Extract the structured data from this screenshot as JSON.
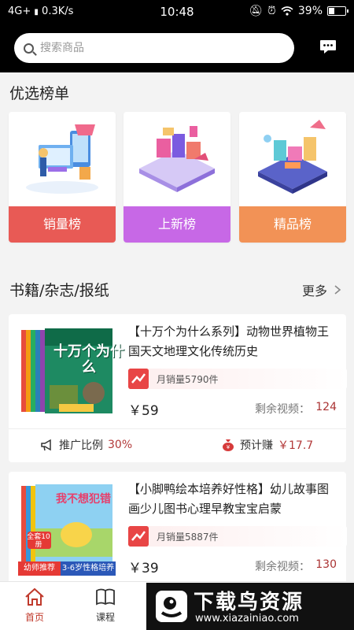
{
  "status": {
    "network": "4G+",
    "speed": "0.3K/s",
    "time": "10:48",
    "battery": "39%",
    "battery_level": 0.39
  },
  "search": {
    "placeholder": "搜索商品"
  },
  "ranking": {
    "title": "优选榜单",
    "items": [
      {
        "label": "销量榜",
        "color": "#e85a55"
      },
      {
        "label": "上新榜",
        "color": "#c768e6"
      },
      {
        "label": "精品榜",
        "color": "#f29256"
      }
    ]
  },
  "books": {
    "title": "书籍/杂志/报纸",
    "more": "更多",
    "items": [
      {
        "title": "【十万个为什么系列】动物世界植物王国天文地理文化传统历史",
        "cover_title": "十万个为什么",
        "sales": "月销量5790件",
        "price": "￥59",
        "remain_label": "剩余视频：",
        "remain_value": "124",
        "promo_label": "推广比例",
        "promo_value": "30%",
        "earn_label": "预计赚",
        "earn_value": "￥17.7"
      },
      {
        "title": "【小脚鸭绘本培养好性格】幼儿故事图画少儿图书心理早教宝宝启蒙",
        "cover_title": "我不想犯错",
        "cover_badge": "全套10册",
        "cover_tag1": "幼师推荐",
        "cover_tag2": "3-6岁性格培养",
        "sales": "月销量5887件",
        "price": "￥39",
        "remain_label": "剩余视频：",
        "remain_value": "130"
      }
    ]
  },
  "tabs": [
    {
      "label": "首页",
      "icon": "home-icon",
      "active": true
    },
    {
      "label": "课程",
      "icon": "book-icon",
      "active": false
    }
  ],
  "watermark": {
    "title": "下载鸟资源",
    "url": "www.xiazainiao.com"
  }
}
